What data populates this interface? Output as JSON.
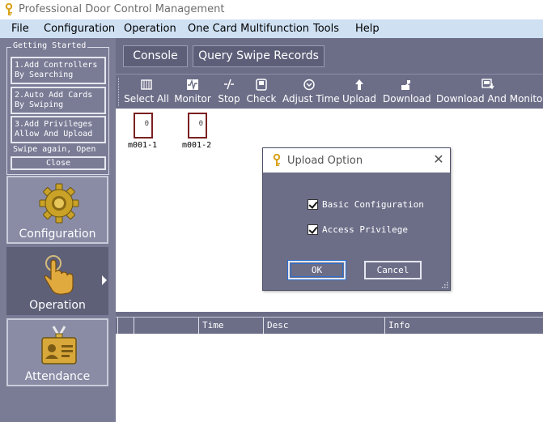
{
  "window": {
    "title": "Professional Door Control Management"
  },
  "menu": [
    "File",
    "Configuration",
    "Operation",
    "One Card Multifunction",
    "Tools",
    "Help"
  ],
  "getting_started": {
    "legend": "Getting Started",
    "steps": [
      {
        "line1": "1.Add Controllers",
        "line2": "By Searching"
      },
      {
        "line1": "2.Auto Add Cards",
        "line2": "By Swiping"
      },
      {
        "line1": "3.Add Privileges",
        "line2": "Allow And Upload"
      }
    ],
    "swipe_text": "Swipe again, Open",
    "close_label": "Close"
  },
  "nav": [
    {
      "label": "Configuration",
      "icon": "gear-icon",
      "active": false
    },
    {
      "label": "Operation",
      "icon": "hand-pointer-icon",
      "active": true
    },
    {
      "label": "Attendance",
      "icon": "id-badge-icon",
      "active": false
    }
  ],
  "tabs": [
    "Console",
    "Query Swipe Records"
  ],
  "toolbar": [
    {
      "label": "Select All",
      "icon": "select-all-icon"
    },
    {
      "label": "Monitor",
      "icon": "monitor-icon"
    },
    {
      "label": "Stop",
      "icon": "stop-icon"
    },
    {
      "label": "Check",
      "icon": "check-icon"
    },
    {
      "label": "Adjust Time",
      "icon": "clock-icon"
    },
    {
      "label": "Upload",
      "icon": "upload-arrow-icon"
    },
    {
      "label": "Download",
      "icon": "download-icon"
    },
    {
      "label": "Download And Monitor",
      "icon": "download-monitor-icon"
    }
  ],
  "doors": [
    {
      "label": "m001-1",
      "number": "0"
    },
    {
      "label": "m001-2",
      "number": "0"
    }
  ],
  "log_columns": [
    "",
    "Time",
    "Desc",
    "Info"
  ],
  "dialog": {
    "title": "Upload Option",
    "options": [
      {
        "label": "Basic Configuration",
        "checked": true
      },
      {
        "label": "Access Privilege",
        "checked": true
      }
    ],
    "ok_label": "OK",
    "cancel_label": "Cancel"
  },
  "colors": {
    "panel": "#6c6e88",
    "menubar": "#cfe0f3",
    "door_border": "#7b2020"
  }
}
